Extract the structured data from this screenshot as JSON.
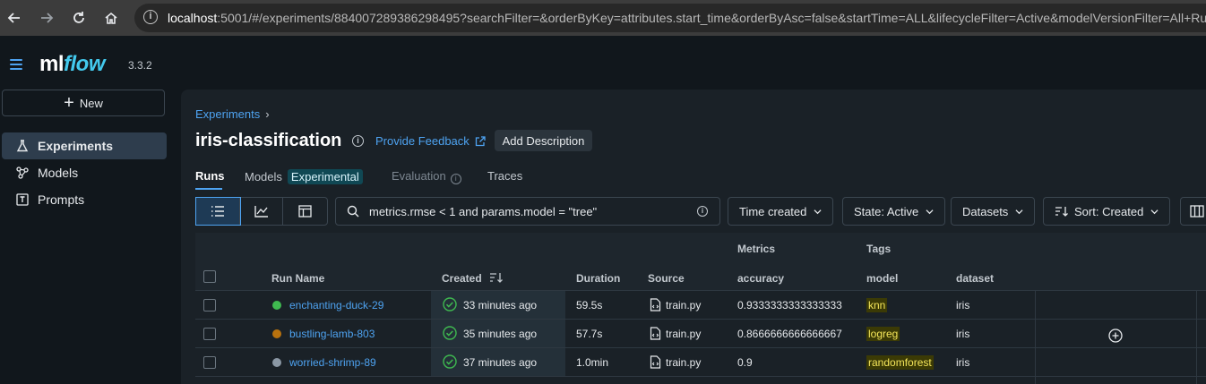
{
  "browser": {
    "url_host": "localhost",
    "url_rest": ":5001/#/experiments/884007289386298495?searchFilter=&orderByKey=attributes.start_time&orderByAsc=false&startTime=ALL&lifecycleFilter=Active&modelVersionFilter=All+Ru",
    "icons": [
      "back-icon",
      "forward-icon",
      "reload-icon",
      "home-icon",
      "site-info-icon"
    ]
  },
  "app": {
    "logo_ml": "ml",
    "logo_flow": "flow",
    "version": "3.3.2"
  },
  "sidebar": {
    "new_label": "New",
    "items": [
      {
        "label": "Experiments",
        "icon": "flask-icon",
        "active": true
      },
      {
        "label": "Models",
        "icon": "models-icon",
        "active": false
      },
      {
        "label": "Prompts",
        "icon": "prompts-icon",
        "active": false
      }
    ]
  },
  "header": {
    "breadcrumb": "Experiments",
    "breadcrumb_sep": "›",
    "title": "iris-classification",
    "feedback": "Provide Feedback",
    "add_description": "Add Description"
  },
  "tabs": {
    "runs": "Runs",
    "models": "Models",
    "models_badge": "Experimental",
    "evaluation": "Evaluation",
    "traces": "Traces"
  },
  "toolbar": {
    "search_value": "metrics.rmse < 1 and params.model = \"tree\"",
    "time_created": "Time created",
    "state": "State: Active",
    "datasets": "Datasets",
    "sort": "Sort: Created"
  },
  "table": {
    "group_metrics": "Metrics",
    "group_tags": "Tags",
    "columns": {
      "run_name": "Run Name",
      "created": "Created",
      "duration": "Duration",
      "source": "Source",
      "accuracy": "accuracy",
      "model": "model",
      "dataset": "dataset"
    },
    "rows": [
      {
        "name": "enchanting-duck-29",
        "color": "#3fb950",
        "created": "33 minutes ago",
        "duration": "59.5s",
        "source": "train.py",
        "accuracy": "0.9333333333333333",
        "model": "knn",
        "dataset": "iris"
      },
      {
        "name": "bustling-lamb-803",
        "color": "#b8720e",
        "created": "35 minutes ago",
        "duration": "57.7s",
        "source": "train.py",
        "accuracy": "0.8666666666666667",
        "model": "logreg",
        "dataset": "iris"
      },
      {
        "name": "worried-shrimp-89",
        "color": "#8b98a5",
        "created": "37 minutes ago",
        "duration": "1.0min",
        "source": "train.py",
        "accuracy": "0.9",
        "model": "randomforest",
        "dataset": "iris"
      }
    ]
  },
  "colors": {
    "accent": "#4ea3f1",
    "success": "#3fb950",
    "tag_highlight": "#f4e55a"
  }
}
